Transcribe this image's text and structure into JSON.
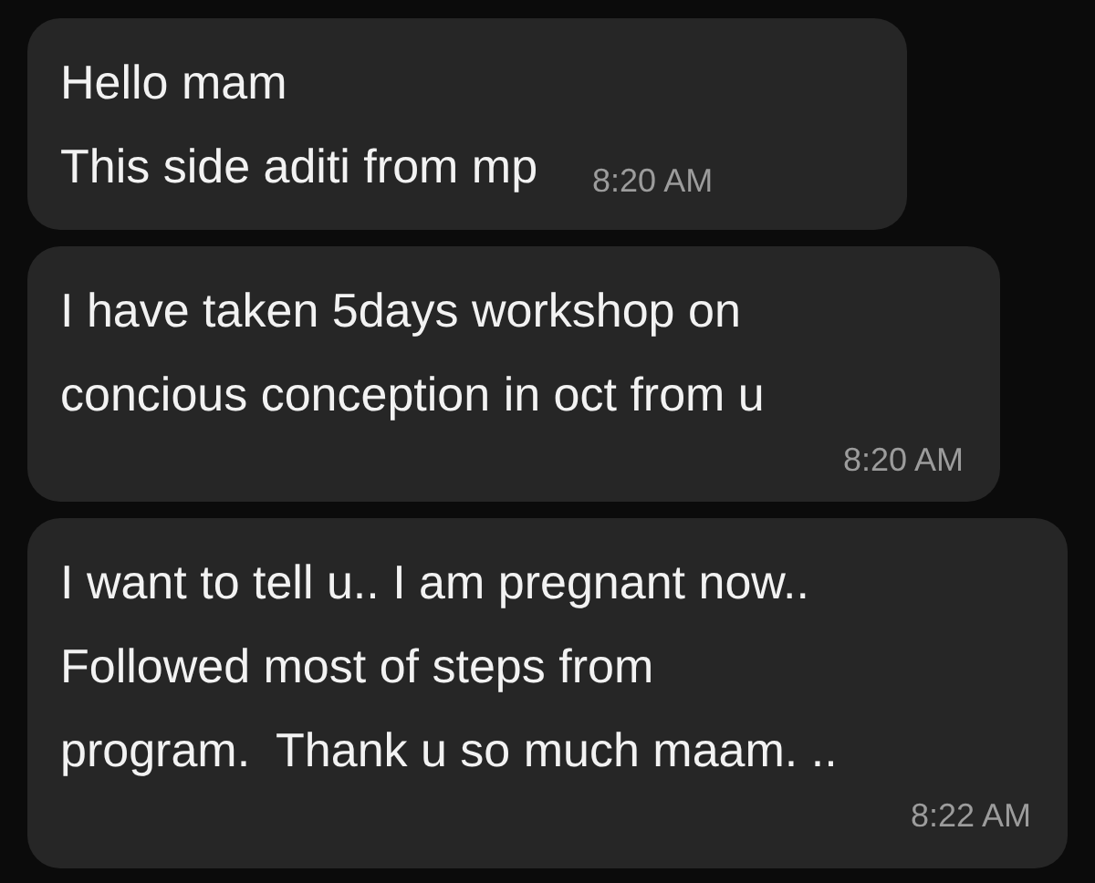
{
  "messages": [
    {
      "text": "Hello mam\nThis side aditi from mp",
      "time": "8:20 AM",
      "kind": "inline"
    },
    {
      "text": "I have taken 5days workshop on\nconcious conception in oct from u",
      "time": "8:20 AM",
      "kind": "below"
    },
    {
      "text": "I want to tell u.. I am pregnant now..\nFollowed most of steps from\nprogram.  Thank u so much maam. ..",
      "time": "8:22 AM",
      "kind": "below"
    }
  ]
}
